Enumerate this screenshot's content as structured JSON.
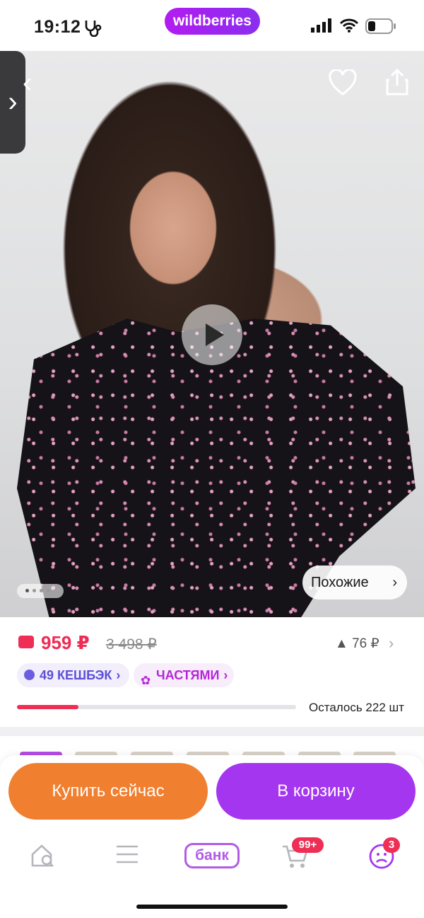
{
  "status_bar": {
    "time": "19:12",
    "brand": "wildberries"
  },
  "product": {
    "similar_label": "Похожие",
    "price": "959 ₽",
    "old_price": "3 498 ₽",
    "price_change": "76 ₽",
    "cashback_label": "49 КЕШБЭК",
    "installments_label": "ЧАСТЯМИ",
    "stock_progress": 0.22,
    "remaining_label": "Осталось 222 шт"
  },
  "actions": {
    "buy_now": "Купить сейчас",
    "add_to_cart": "В корзину"
  },
  "tabbar": {
    "bank_label": "банк",
    "cart_count": "99+",
    "profile_count": "3"
  },
  "colors": {
    "price": "#ee2b54",
    "buy": "#f07f2f",
    "cart": "#a436ef",
    "brand": "#b21cf0"
  }
}
